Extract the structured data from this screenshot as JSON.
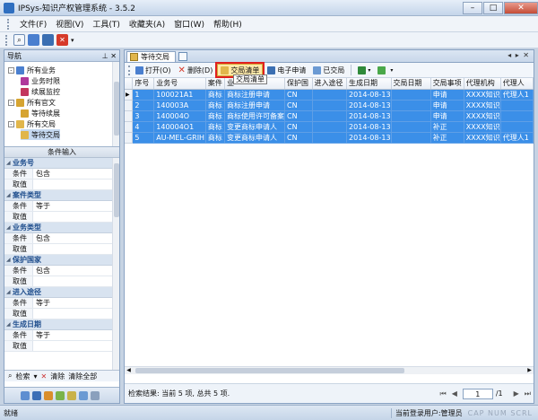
{
  "window": {
    "title": "IPSys-知识产权管理系统 - 3.5.2"
  },
  "menu": [
    "文件(F)",
    "视图(V)",
    "工具(T)",
    "收藏夹(A)",
    "窗口(W)",
    "帮助(H)"
  ],
  "nav": {
    "title": "导航",
    "tree": [
      {
        "label": "所有业务",
        "level": 0,
        "expander": "-",
        "color": "#4a7fcf"
      },
      {
        "label": "业务时限",
        "level": 1,
        "color": "#b0389b"
      },
      {
        "label": "续展监控",
        "level": 1,
        "color": "#c3365c"
      },
      {
        "label": "所有官文",
        "level": 0,
        "expander": "-",
        "color": "#d6a431"
      },
      {
        "label": "等待续展",
        "level": 1,
        "color": "#d6a431"
      },
      {
        "label": "所有交局",
        "level": 0,
        "expander": "-",
        "color": "#e1b64b"
      },
      {
        "label": "等待交局",
        "level": 1,
        "color": "#e1b64b",
        "selected": true
      }
    ]
  },
  "conditions": {
    "title": "条件输入",
    "groups": [
      {
        "name": "业务号",
        "rows": [
          {
            "k": "条件",
            "v": "包含"
          },
          {
            "k": "取值",
            "v": ""
          }
        ]
      },
      {
        "name": "案件类型",
        "rows": [
          {
            "k": "条件",
            "v": "等于"
          },
          {
            "k": "取值",
            "v": ""
          }
        ]
      },
      {
        "name": "业务类型",
        "rows": [
          {
            "k": "条件",
            "v": "包含"
          },
          {
            "k": "取值",
            "v": ""
          }
        ]
      },
      {
        "name": "保护国家",
        "rows": [
          {
            "k": "条件",
            "v": "包含"
          },
          {
            "k": "取值",
            "v": ""
          }
        ]
      },
      {
        "name": "进入途径",
        "rows": [
          {
            "k": "条件",
            "v": "等于"
          },
          {
            "k": "取值",
            "v": ""
          }
        ]
      },
      {
        "name": "生成日期",
        "rows": [
          {
            "k": "条件",
            "v": "等于"
          },
          {
            "k": "取值",
            "v": ""
          }
        ]
      }
    ],
    "search": "检索",
    "clear": "清除",
    "clear_all": "清除全部"
  },
  "tab": {
    "label": "等待交局"
  },
  "actions": {
    "open": "打开(O)",
    "delete": "删除(D)",
    "list": "交局清单",
    "eapply": "电子申请",
    "submitted": "已交局",
    "tooltip": "交局清单"
  },
  "grid": {
    "columns": [
      "序号",
      "业务号",
      "案件",
      "业",
      "保护国",
      "进入途径",
      "生成日期",
      "交局日期",
      "交局事项",
      "代理机构",
      "代理人"
    ],
    "rows": [
      [
        "1",
        "100021A1",
        "商标",
        "商标注册申请",
        "CN",
        "",
        "2014-08-13",
        "",
        "申请",
        "XXXX知识",
        "代理人1"
      ],
      [
        "2",
        "140003A",
        "商标",
        "商标注册申请",
        "CN",
        "",
        "2014-08-13",
        "",
        "申请",
        "XXXX知识",
        ""
      ],
      [
        "3",
        "140004O",
        "商标",
        "商标使用许可备案",
        "CN",
        "",
        "2014-08-13",
        "",
        "申请",
        "XXXX知识",
        ""
      ],
      [
        "4",
        "140004O1",
        "商标",
        "变更商标申请人",
        "CN",
        "",
        "2014-08-13",
        "",
        "补正",
        "XXXX知识",
        ""
      ],
      [
        "5",
        "AU-MEL-GRIH",
        "商标",
        "变更商标申请人",
        "CN",
        "",
        "2014-08-13",
        "",
        "补正",
        "XXXX知识",
        "代理人1"
      ]
    ]
  },
  "pager": {
    "summary": "检索结果: 当前 5 项, 总共 5 项.",
    "page": "1",
    "total": "/1"
  },
  "status": {
    "left": "就绪",
    "user": "当前登录用户:管理员",
    "locks": "CAP NUM SCRL"
  }
}
